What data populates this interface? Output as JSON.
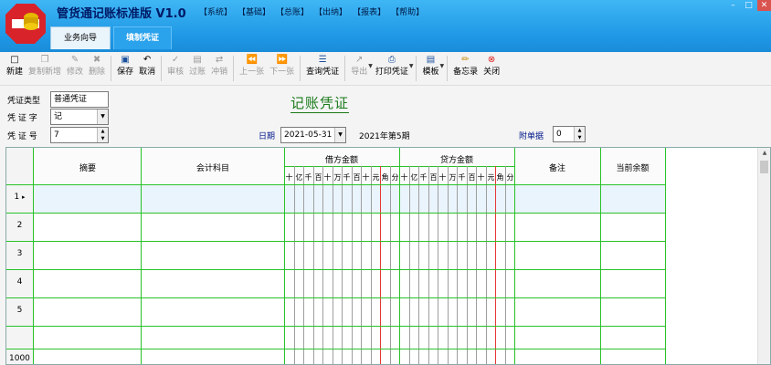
{
  "app": {
    "title": "管货通记账标准版 V1.0",
    "menu": [
      "【系统】",
      "【基础】",
      "【总账】",
      "【出纳】",
      "【报表】",
      "【帮助】"
    ],
    "window_buttons": [
      "–",
      "□",
      "✕"
    ]
  },
  "tabs": [
    {
      "label": "业务向导",
      "active": false
    },
    {
      "label": "填制凭证",
      "active": true
    }
  ],
  "toolbar": {
    "new": "新建",
    "copy_new": "复制新增",
    "modify": "修改",
    "delete": "删除",
    "save": "保存",
    "cancel": "取消",
    "audit": "审核",
    "post": "过账",
    "reverse": "冲销",
    "prev": "上一张",
    "next": "下一张",
    "query": "查询凭证",
    "export": "导出",
    "print": "打印凭证",
    "template": "模板",
    "memo": "备忘录",
    "close": "关闭"
  },
  "form": {
    "voucher_type_label": "凭证类型",
    "voucher_type_value": "普通凭证",
    "voucher_word_label": "凭 证 字",
    "voucher_word_value": "记",
    "voucher_no_label": "凭 证 号",
    "voucher_no_value": "7",
    "title": "记账凭证",
    "date_label": "日期",
    "date_value": "2021-05-31",
    "period": "2021年第5期",
    "attach_label": "附单据",
    "attach_value": "0"
  },
  "grid": {
    "headers": {
      "summary": "摘要",
      "account": "会计科目",
      "debit": "借方金额",
      "credit": "贷方金额",
      "remark": "备注",
      "balance": "当前余额"
    },
    "digits": [
      "十",
      "亿",
      "千",
      "百",
      "十",
      "万",
      "千",
      "百",
      "十",
      "元",
      "角",
      "分"
    ],
    "rows": [
      "1",
      "2",
      "3",
      "4",
      "5",
      "",
      "1000"
    ],
    "current_row_marker": "▸"
  }
}
